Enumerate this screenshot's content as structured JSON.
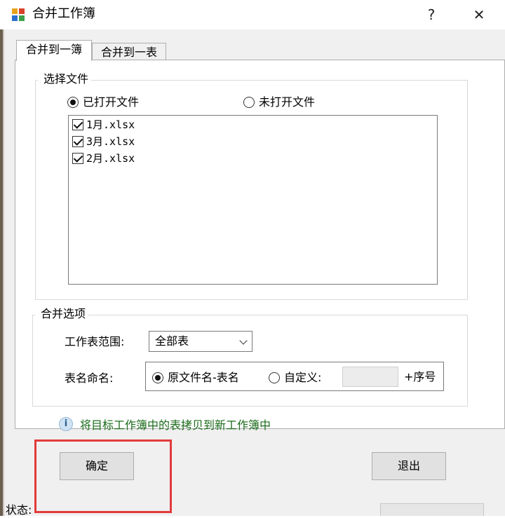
{
  "window": {
    "title": "合并工作簿",
    "help": "?",
    "close": "✕"
  },
  "tabs": [
    {
      "label": "合并到一簿"
    },
    {
      "label": "合并到一表"
    }
  ],
  "file_group": {
    "legend": "选择文件",
    "radio_open": "已打开文件",
    "radio_unopened": "未打开文件",
    "files": [
      {
        "name": "1月.xlsx",
        "checked": true
      },
      {
        "name": "3月.xlsx",
        "checked": true
      },
      {
        "name": "2月.xlsx",
        "checked": true
      }
    ]
  },
  "options_group": {
    "legend": "合并选项",
    "range_label": "工作表范围:",
    "range_value": "全部表",
    "naming_label": "表名命名:",
    "naming_original": "原文件名-表名",
    "naming_custom": "自定义:",
    "custom_value": "",
    "serial_suffix": "+序号"
  },
  "info": {
    "text": "将目标工作簿中的表拷贝到新工作簿中"
  },
  "buttons": {
    "ok": "确定",
    "exit": "退出"
  },
  "status": {
    "label": "状态:"
  },
  "colors": {
    "highlight": "#e23b3b",
    "info_text": "#1a6b1a"
  }
}
